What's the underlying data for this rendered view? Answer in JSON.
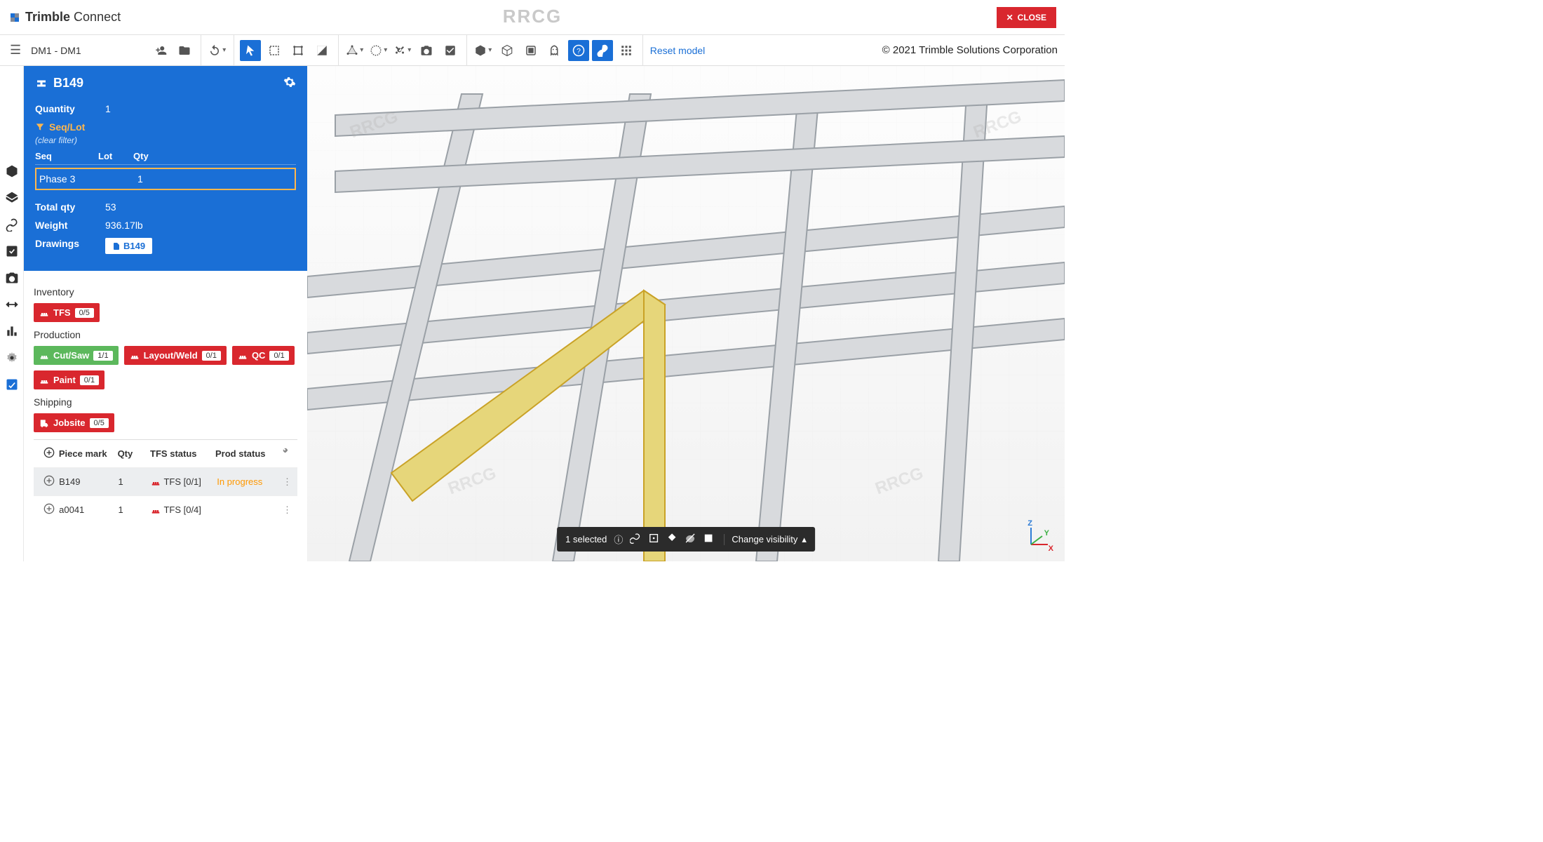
{
  "header": {
    "logo_brand": "Trimble",
    "logo_product": "Connect",
    "watermark": "RRCG",
    "close_label": "CLOSE"
  },
  "toolbar": {
    "breadcrumb": "DM1 - DM1",
    "reset_link": "Reset model",
    "copyright": "© 2021 Trimble Solutions Corporation"
  },
  "panel": {
    "title": "B149",
    "quantity_label": "Quantity",
    "quantity_value": "1",
    "seqlot_label": "Seq/Lot",
    "clear_filter": "(clear filter)",
    "seq_head": {
      "c1": "Seq",
      "c2": "Lot",
      "c3": "Qty"
    },
    "seq_row": {
      "c1": "Phase 3",
      "c2": "",
      "c3": "1"
    },
    "totalqty_label": "Total qty",
    "totalqty_value": "53",
    "weight_label": "Weight",
    "weight_value": "936.17lb",
    "drawings_label": "Drawings",
    "drawing_chip": "B149",
    "inventory": {
      "title": "Inventory",
      "chips": [
        {
          "label": "TFS",
          "count": "0/5",
          "color": "red",
          "icon": "pallet"
        }
      ]
    },
    "production": {
      "title": "Production",
      "chips": [
        {
          "label": "Cut/Saw",
          "count": "1/1",
          "color": "green",
          "icon": "pallet"
        },
        {
          "label": "Layout/Weld",
          "count": "0/1",
          "color": "red",
          "icon": "pallet"
        },
        {
          "label": "QC",
          "count": "0/1",
          "color": "red",
          "icon": "pallet"
        },
        {
          "label": "Paint",
          "count": "0/1",
          "color": "red",
          "icon": "pallet"
        }
      ]
    },
    "shipping": {
      "title": "Shipping",
      "chips": [
        {
          "label": "Jobsite",
          "count": "0/5",
          "color": "red",
          "icon": "truck"
        }
      ]
    }
  },
  "table": {
    "head": {
      "piece": "Piece mark",
      "qty": "Qty",
      "tfs": "TFS status",
      "prod": "Prod status"
    },
    "rows": [
      {
        "piece": "B149",
        "qty": "1",
        "tfs": "TFS [0/1]",
        "prod": "In progress",
        "selected": true,
        "prod_orange": true
      },
      {
        "piece": "a0041",
        "qty": "1",
        "tfs": "TFS [0/4]",
        "prod": "",
        "selected": false,
        "prod_orange": false
      }
    ]
  },
  "floating_bar": {
    "selected_text": "1 selected",
    "dropdown_label": "Change visibility"
  },
  "axis": {
    "x": "X",
    "y": "Y",
    "z": "Z"
  }
}
